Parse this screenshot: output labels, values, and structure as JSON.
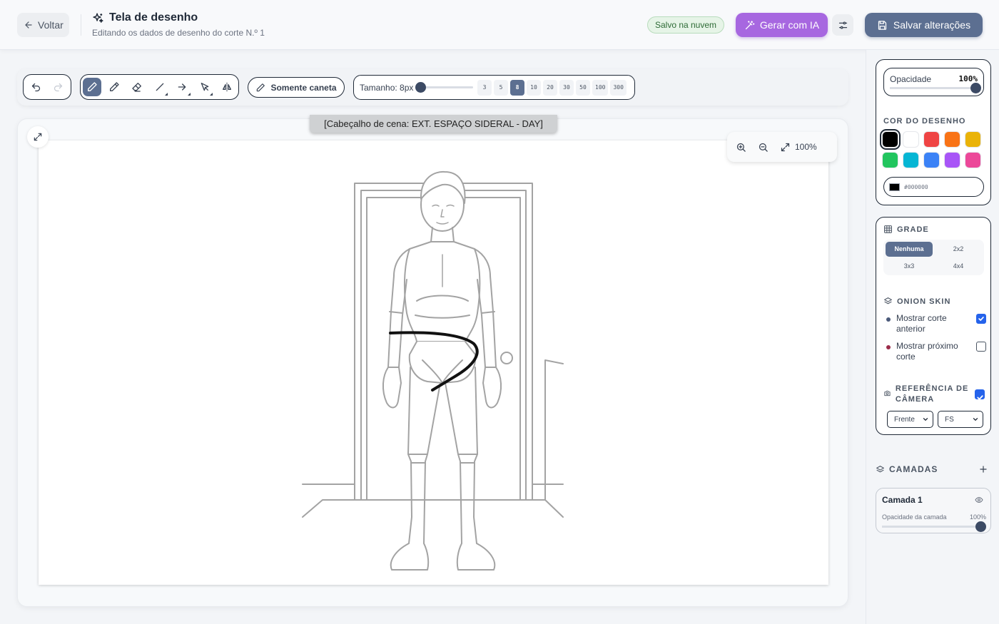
{
  "header": {
    "back_label": "Voltar",
    "title": "Tela de desenho",
    "subtitle": "Editando os dados de desenho do corte N.º 1",
    "saved_badge": "Salvo na nuvem",
    "ai_button": "Gerar com IA",
    "save_button": "Salvar alterações"
  },
  "toolbar": {
    "tools": [
      "pencil-icon",
      "pen-icon",
      "eraser-icon",
      "line-icon",
      "arrow-icon",
      "select-icon",
      "mirror-icon"
    ],
    "active_tool": "pencil-icon",
    "pen_only_label": "Somente caneta",
    "size_label": "Tamanho: 8px",
    "size_value": 8,
    "size_presets": [
      "3",
      "5",
      "8",
      "10",
      "20",
      "30",
      "50",
      "100",
      "300"
    ],
    "active_size": "8"
  },
  "canvas": {
    "scene_heading": "[Cabeçalho de cena: EXT. ESPAÇO SIDERAL - DAY]",
    "zoom": "100%"
  },
  "right_panel": {
    "opacity_label": "Opacidade",
    "opacity_value": "100%",
    "color_section": "COR DO DESENHO",
    "colors": [
      "#000000",
      "#ffffff",
      "#ef4444",
      "#f97316",
      "#eab308",
      "#22c55e",
      "#06b6d4",
      "#3b82f6",
      "#a855f7",
      "#ec4899"
    ],
    "selected_color": "#000000",
    "hex_value": "#000000",
    "grid_section": "GRADE",
    "grid_options": [
      "Nenhuma",
      "2x2",
      "3x3",
      "4x4"
    ],
    "grid_selected": "Nenhuma",
    "onion_section": "ONION SKIN",
    "onion_prev": "Mostrar corte anterior",
    "onion_prev_checked": true,
    "onion_next": "Mostrar próximo corte",
    "onion_next_checked": false,
    "onion_prev_color": "#4b5a7a",
    "onion_next_color": "#9b2c4a",
    "camera_section": "REFERÊNCIA DE CÂMERA",
    "camera_checked": true,
    "camera_angle": "Frente",
    "camera_shot": "FS",
    "layers_section": "CAMADAS",
    "layers": [
      {
        "name": "Camada 1",
        "opacity_label": "Opacidade da camada",
        "opacity_value": "100%"
      }
    ]
  }
}
